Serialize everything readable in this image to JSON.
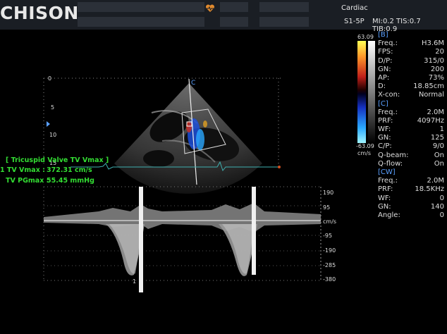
{
  "header": {
    "logo": "CHISON",
    "preset": "Cardiac",
    "probe": "S1-5P",
    "indices": "MI:0.2 TIS:0.7 TIB:0.9",
    "heart_icon": "heart-pulse-icon"
  },
  "colorbar": {
    "top": "63.09",
    "bottom": "-63.09",
    "unit": "cm/s"
  },
  "params": [
    {
      "type": "section",
      "label": "[B]"
    },
    {
      "label": "Freq.:",
      "value": "H3.6M"
    },
    {
      "label": "FPS:",
      "value": "20"
    },
    {
      "label": "D/P:",
      "value": "315/0"
    },
    {
      "label": "GN:",
      "value": "200"
    },
    {
      "label": "AP:",
      "value": "73%"
    },
    {
      "label": "D:",
      "value": "18.85cm"
    },
    {
      "label": "X-con:",
      "value": "Normal"
    },
    {
      "type": "section",
      "label": "[C]"
    },
    {
      "label": "Freq.:",
      "value": "2.0M"
    },
    {
      "label": "PRF:",
      "value": "4097Hz"
    },
    {
      "label": "WF:",
      "value": "1"
    },
    {
      "label": "GN:",
      "value": "125"
    },
    {
      "label": "C/P:",
      "value": "9/0"
    },
    {
      "label": "Q-beam:",
      "value": "On"
    },
    {
      "label": "Q-flow:",
      "value": "On"
    },
    {
      "type": "section",
      "label": "[CW]"
    },
    {
      "label": "Freq.:",
      "value": "2.0M"
    },
    {
      "label": "PRF:",
      "value": "18.5KHz"
    },
    {
      "label": "WF:",
      "value": "0"
    },
    {
      "label": "GN:",
      "value": "140"
    },
    {
      "label": "Angle:",
      "value": "0"
    }
  ],
  "measurement": {
    "title": "[ Tricuspid Valve TV Vmax ]",
    "line1_label": "1 TV Vmax  :",
    "line1_value": "372.31 cm/s",
    "line2_label": "TV PGmax  :",
    "line2_value": "55.45 mmHg"
  },
  "bmode": {
    "depth_ticks": [
      "0",
      "5",
      "10",
      "15"
    ],
    "marker": "C"
  },
  "doppler": {
    "scale_ticks": [
      "190",
      "95",
      "cm/s",
      "-95",
      "-190",
      "-285",
      "-380"
    ],
    "caliper": "1"
  },
  "colors": {
    "accent_measure": "#33dd33",
    "section": "#5aa0ff",
    "header_bg": "#1a1e24"
  }
}
